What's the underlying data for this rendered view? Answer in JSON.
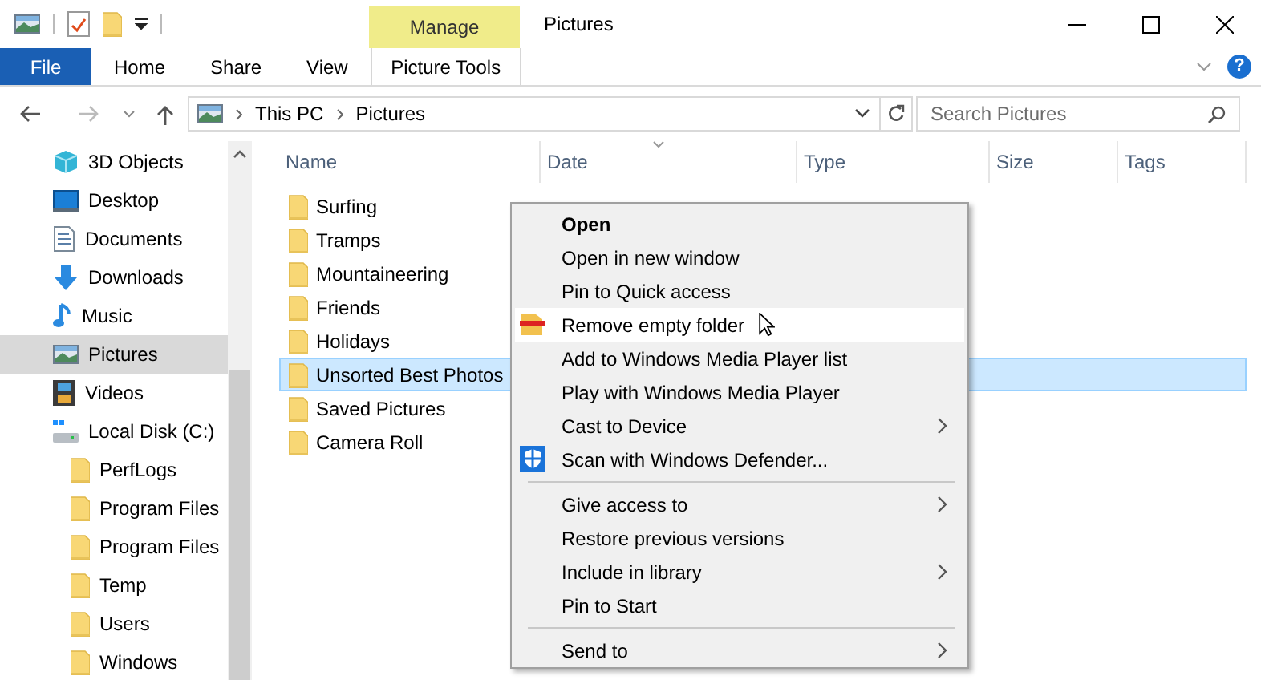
{
  "window": {
    "title": "Pictures"
  },
  "contextual_tab": {
    "label": "Manage"
  },
  "ribbon_tabs": [
    {
      "label": "File",
      "kind": "file"
    },
    {
      "label": "Home",
      "kind": "plain"
    },
    {
      "label": "Share",
      "kind": "plain"
    },
    {
      "label": "View",
      "kind": "plain"
    },
    {
      "label": "Picture Tools",
      "kind": "contextual"
    }
  ],
  "address_bar": {
    "path": [
      "This PC",
      "Pictures"
    ]
  },
  "help_button": {
    "label": "?"
  },
  "search": {
    "placeholder": "Search Pictures"
  },
  "nav_pane": {
    "items": [
      {
        "label": "3D Objects",
        "kind": "cube",
        "selected": false
      },
      {
        "label": "Desktop",
        "kind": "desktop",
        "selected": false
      },
      {
        "label": "Documents",
        "kind": "document",
        "selected": false
      },
      {
        "label": "Downloads",
        "kind": "download",
        "selected": false
      },
      {
        "label": "Music",
        "kind": "music",
        "selected": false
      },
      {
        "label": "Pictures",
        "kind": "picture",
        "selected": true
      },
      {
        "label": "Videos",
        "kind": "video",
        "selected": false
      },
      {
        "label": "Local Disk (C:)",
        "kind": "drive",
        "selected": false,
        "children": [
          {
            "label": "PerfLogs",
            "kind": "folder",
            "selected": false
          },
          {
            "label": "Program Files",
            "kind": "folder",
            "selected": false
          },
          {
            "label": "Program Files",
            "kind": "folder",
            "selected": false
          },
          {
            "label": "Temp",
            "kind": "folder",
            "selected": false
          },
          {
            "label": "Users",
            "kind": "folder",
            "selected": false
          },
          {
            "label": "Windows",
            "kind": "folder",
            "selected": false
          }
        ]
      }
    ]
  },
  "file_list": {
    "columns": [
      "Name",
      "Date",
      "Type",
      "Size",
      "Tags"
    ],
    "rows": [
      {
        "name": "Surfing",
        "selected": false
      },
      {
        "name": "Tramps",
        "selected": false
      },
      {
        "name": "Mountaineering",
        "selected": false
      },
      {
        "name": "Friends",
        "selected": false
      },
      {
        "name": "Holidays",
        "selected": false
      },
      {
        "name": "Unsorted Best Photos",
        "selected": true
      },
      {
        "name": "Saved Pictures",
        "selected": false
      },
      {
        "name": "Camera Roll",
        "selected": false
      }
    ]
  },
  "context_menu": {
    "items": [
      {
        "kind": "default",
        "label": "Open",
        "submenu": false,
        "selected": false
      },
      {
        "kind": "item",
        "label": "Open in new window",
        "submenu": false,
        "selected": false
      },
      {
        "kind": "item",
        "label": "Pin to Quick access",
        "submenu": false,
        "selected": false
      },
      {
        "kind": "folder-remove",
        "label": "Remove empty folder",
        "submenu": false,
        "selected": true
      },
      {
        "kind": "item",
        "label": "Add to Windows Media Player list",
        "submenu": false,
        "selected": false
      },
      {
        "kind": "item",
        "label": "Play with Windows Media Player",
        "submenu": false,
        "selected": false
      },
      {
        "kind": "item",
        "label": "Cast to Device",
        "submenu": true,
        "selected": false
      },
      {
        "kind": "shield",
        "label": "Scan with Windows Defender...",
        "submenu": false,
        "selected": false
      },
      {
        "kind": "separator"
      },
      {
        "kind": "item",
        "label": "Give access to",
        "submenu": true,
        "selected": false
      },
      {
        "kind": "item",
        "label": "Restore previous versions",
        "submenu": false,
        "selected": false
      },
      {
        "kind": "item",
        "label": "Include in library",
        "submenu": true,
        "selected": false
      },
      {
        "kind": "item",
        "label": "Pin to Start",
        "submenu": false,
        "selected": false
      },
      {
        "kind": "separator"
      },
      {
        "kind": "item",
        "label": "Send to",
        "submenu": true,
        "selected": false
      }
    ]
  }
}
